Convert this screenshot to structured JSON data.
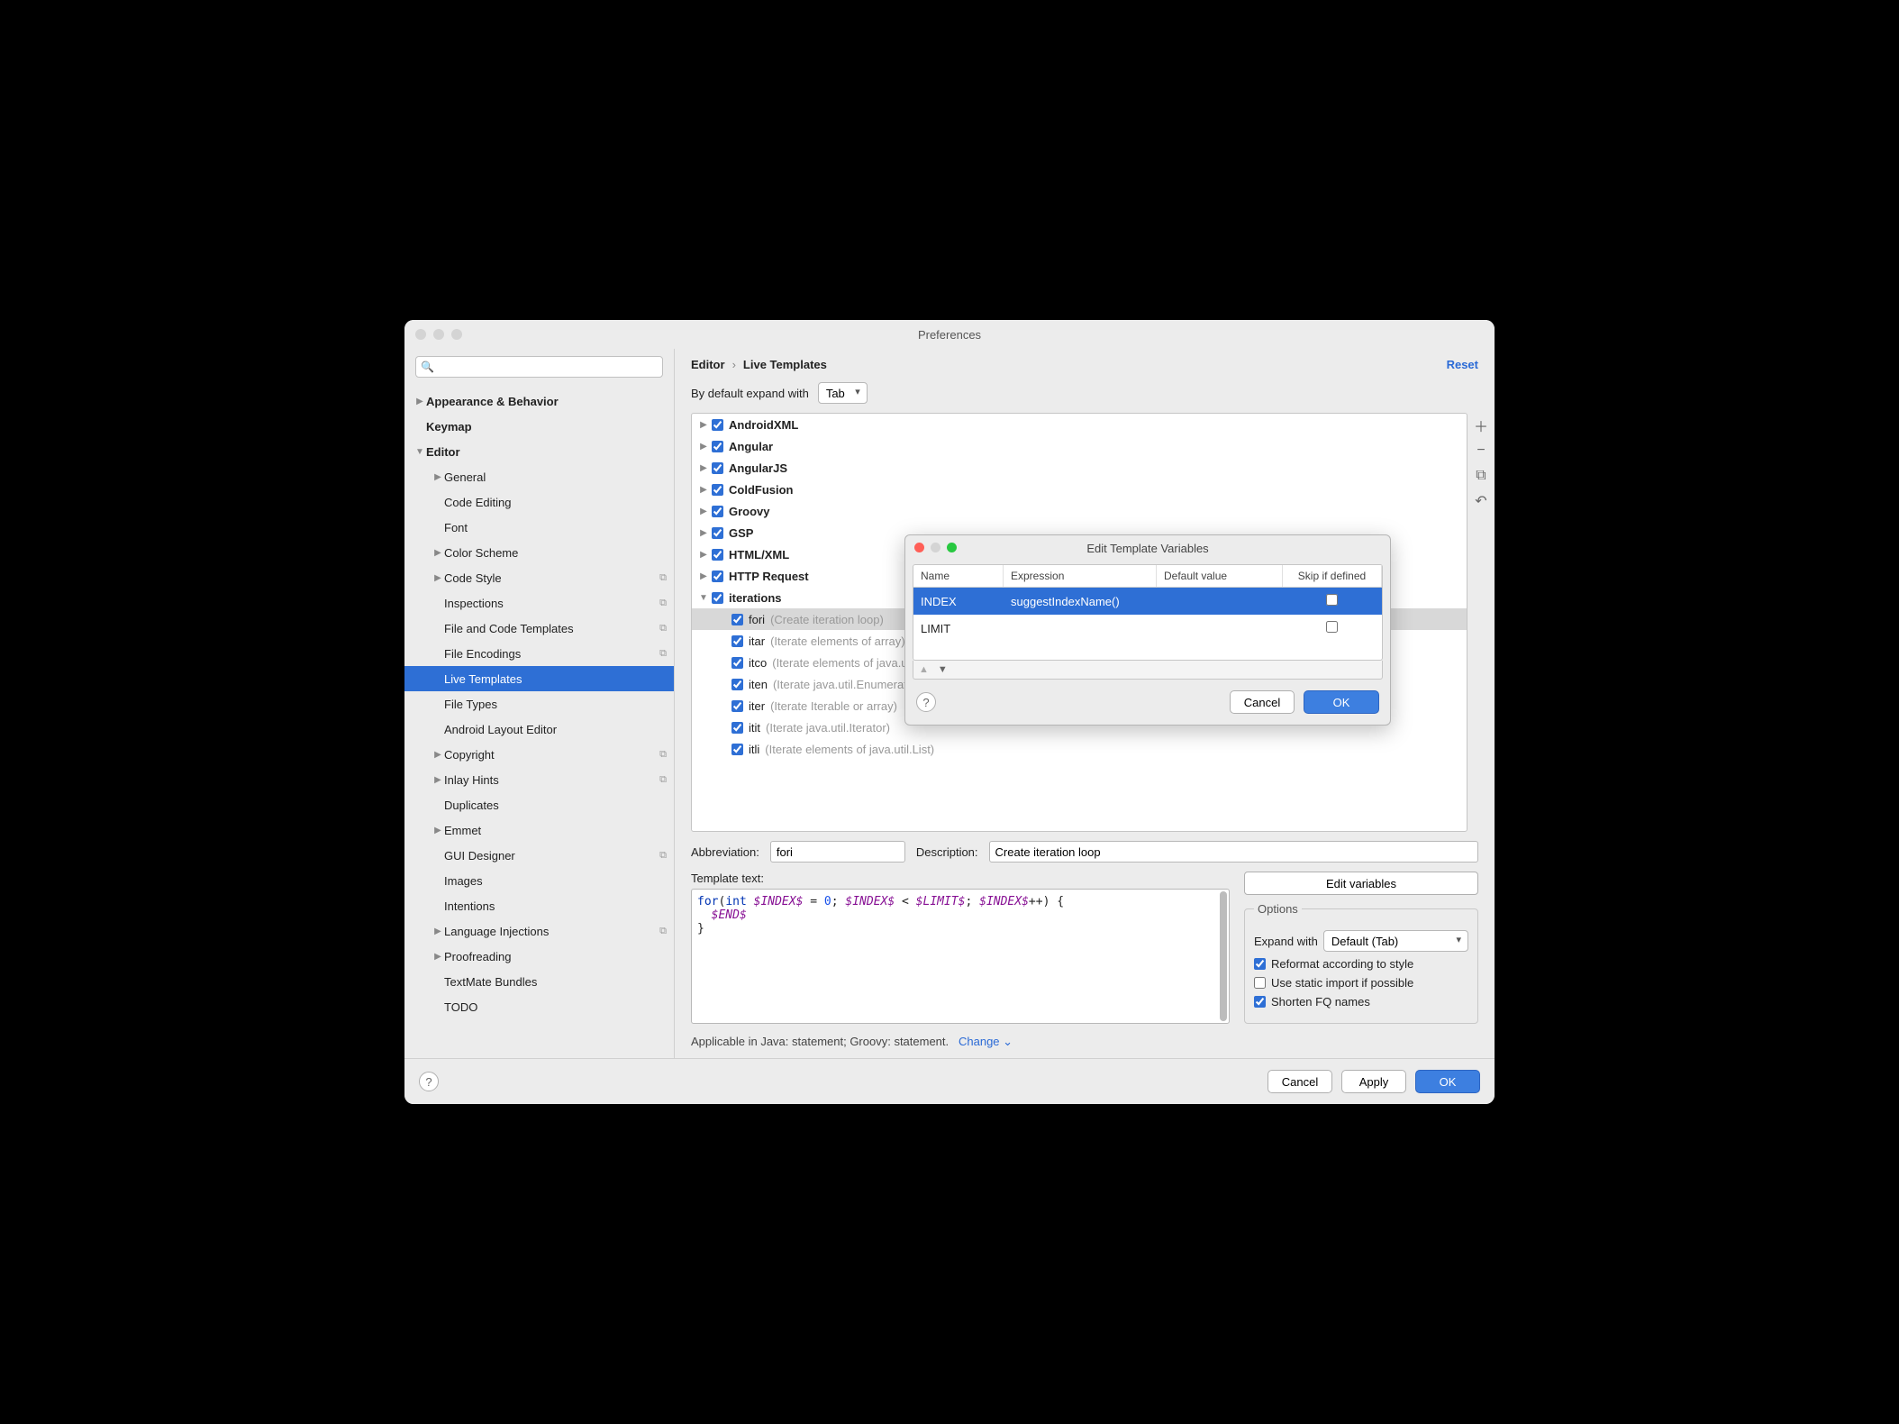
{
  "window": {
    "title": "Preferences"
  },
  "breadcrumb": {
    "section": "Editor",
    "page": "Live Templates",
    "reset": "Reset"
  },
  "expand": {
    "label": "By default expand with",
    "value": "Tab"
  },
  "sidebar": {
    "items": [
      {
        "label": "Appearance & Behavior",
        "arrow": "▶",
        "bold": true
      },
      {
        "label": "Keymap",
        "bold": true
      },
      {
        "label": "Editor",
        "arrow": "▼",
        "bold": true
      },
      {
        "label": "General",
        "arrow": "▶",
        "indent": 1
      },
      {
        "label": "Code Editing",
        "indent": 1
      },
      {
        "label": "Font",
        "indent": 1
      },
      {
        "label": "Color Scheme",
        "arrow": "▶",
        "indent": 1
      },
      {
        "label": "Code Style",
        "arrow": "▶",
        "indent": 1,
        "dup": true
      },
      {
        "label": "Inspections",
        "indent": 1,
        "dup": true
      },
      {
        "label": "File and Code Templates",
        "indent": 1,
        "dup": true
      },
      {
        "label": "File Encodings",
        "indent": 1,
        "dup": true
      },
      {
        "label": "Live Templates",
        "indent": 1,
        "selected": true
      },
      {
        "label": "File Types",
        "indent": 1
      },
      {
        "label": "Android Layout Editor",
        "indent": 1
      },
      {
        "label": "Copyright",
        "arrow": "▶",
        "indent": 1,
        "dup": true
      },
      {
        "label": "Inlay Hints",
        "arrow": "▶",
        "indent": 1,
        "dup": true
      },
      {
        "label": "Duplicates",
        "indent": 1
      },
      {
        "label": "Emmet",
        "arrow": "▶",
        "indent": 1
      },
      {
        "label": "GUI Designer",
        "indent": 1,
        "dup": true
      },
      {
        "label": "Images",
        "indent": 1
      },
      {
        "label": "Intentions",
        "indent": 1
      },
      {
        "label": "Language Injections",
        "arrow": "▶",
        "indent": 1,
        "dup": true
      },
      {
        "label": "Proofreading",
        "arrow": "▶",
        "indent": 1
      },
      {
        "label": "TextMate Bundles",
        "indent": 1
      },
      {
        "label": "TODO",
        "indent": 1
      }
    ]
  },
  "templates": {
    "groups": [
      {
        "name": "AndroidXML",
        "arrow": "▶"
      },
      {
        "name": "Angular",
        "arrow": "▶"
      },
      {
        "name": "AngularJS",
        "arrow": "▶"
      },
      {
        "name": "ColdFusion",
        "arrow": "▶"
      },
      {
        "name": "Groovy",
        "arrow": "▶"
      },
      {
        "name": "GSP",
        "arrow": "▶"
      },
      {
        "name": "HTML/XML",
        "arrow": "▶"
      },
      {
        "name": "HTTP Request",
        "arrow": "▶"
      },
      {
        "name": "iterations",
        "arrow": "▼",
        "expanded": true,
        "children": [
          {
            "name": "fori",
            "desc": "(Create iteration loop)",
            "sel": true
          },
          {
            "name": "itar",
            "desc": "(Iterate elements of array)"
          },
          {
            "name": "itco",
            "desc": "(Iterate elements of java.util.Collection)"
          },
          {
            "name": "iten",
            "desc": "(Iterate java.util.Enumeration)"
          },
          {
            "name": "iter",
            "desc": "(Iterate Iterable or array)"
          },
          {
            "name": "itit",
            "desc": "(Iterate java.util.Iterator)"
          },
          {
            "name": "itli",
            "desc": "(Iterate elements of java.util.List)"
          }
        ]
      }
    ]
  },
  "form": {
    "abbr_label": "Abbreviation:",
    "abbr_value": "fori",
    "desc_label": "Description:",
    "desc_value": "Create iteration loop",
    "template_text_label": "Template text:",
    "edit_variables": "Edit variables",
    "options_label": "Options",
    "expand_with_label": "Expand with",
    "expand_with_value": "Default (Tab)",
    "reformat": "Reformat according to style",
    "static_import": "Use static import if possible",
    "shorten": "Shorten FQ names"
  },
  "applicable": {
    "text": "Applicable in Java: statement; Groovy: statement.",
    "change": "Change"
  },
  "footer": {
    "cancel": "Cancel",
    "apply": "Apply",
    "ok": "OK"
  },
  "modal": {
    "title": "Edit Template Variables",
    "headers": {
      "name": "Name",
      "expr": "Expression",
      "def": "Default value",
      "skip": "Skip if defined"
    },
    "rows": [
      {
        "name": "INDEX",
        "expr": "suggestIndexName()",
        "def": "",
        "skip": false,
        "selected": true
      },
      {
        "name": "LIMIT",
        "expr": "",
        "def": "",
        "skip": false
      }
    ],
    "cancel": "Cancel",
    "ok": "OK"
  }
}
